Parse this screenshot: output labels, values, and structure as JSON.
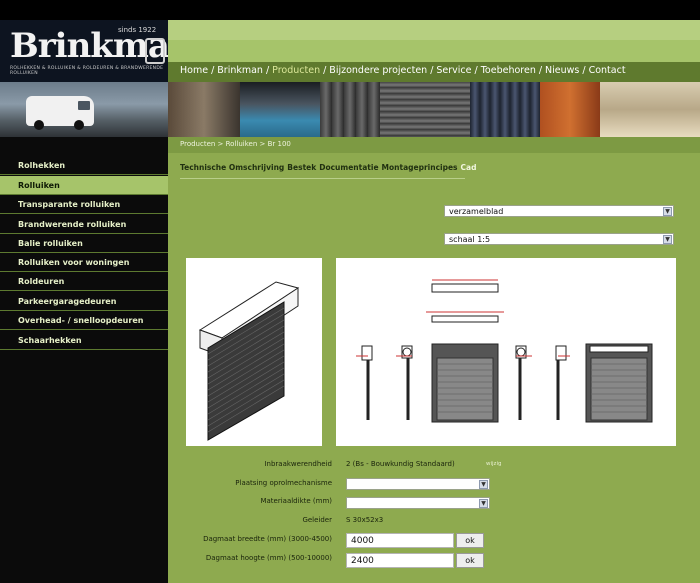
{
  "brand": {
    "name": "Brinkman",
    "since": "sinds 1922",
    "tagline": "ROLHEKKEN & ROLLUIKEN & ROLDEUREN & BRANDWERENDE ROLLUIKEN"
  },
  "nav": {
    "items": [
      "Home",
      "Brinkman",
      "Producten",
      "Bijzondere projecten",
      "Service",
      "Toebehoren",
      "Nieuws",
      "Contact"
    ],
    "active": "Producten",
    "separator": "/"
  },
  "breadcrumb": "Producten > Rolluiken > Br 100",
  "tabs": [
    "Technische Omschrijving",
    "Bestek",
    "Documentatie",
    "Montageprincipes",
    "Cad"
  ],
  "active_tab": "Cad",
  "sidebar": {
    "items": [
      "Rolhekken",
      "Rolluiken",
      "Transparante rolluiken",
      "Brandwerende rolluiken",
      "Balie rolluiken",
      "Rolluiken voor woningen",
      "Roldeuren",
      "Parkeergaragedeuren",
      "Overhead- / snelloopdeuren",
      "Schaarhekken"
    ],
    "active": "Rolluiken"
  },
  "selects": {
    "sheet": "verzamelblad",
    "scale": "schaal 1:5"
  },
  "form": {
    "inbraak_label": "Inbraakwerendheid",
    "inbraak_value": "2 (Bs - Bouwkundig Standaard)",
    "inbraak_link": "wijzig",
    "plaatsing_label": "Plaatsing oprolmechanisme",
    "plaatsing_value": "",
    "materiaal_label": "Materiaaldikte (mm)",
    "materiaal_value": "",
    "geleider_label": "Geleider",
    "geleider_value": "S 30x52x3",
    "breedte_label": "Dagmaat breedte (mm) (3000-4500)",
    "breedte_value": "4000",
    "hoogte_label": "Dagmaat hoogte (mm) (500-10000)",
    "hoogte_value": "2400",
    "ok_label": "ok"
  },
  "colors": {
    "header_green": "#a6c46a",
    "content_green": "#8eaa4f",
    "nav_dark": "#5f7a2e",
    "sidebar_bg": "#0b0b0b"
  }
}
